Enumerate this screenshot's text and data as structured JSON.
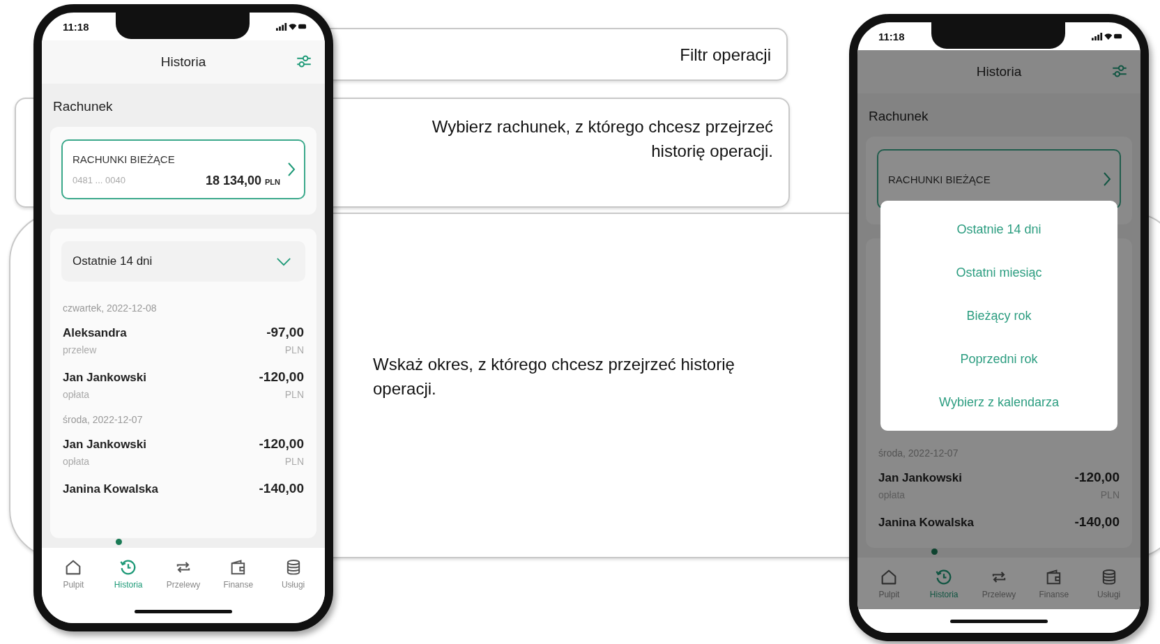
{
  "annotations": [
    {
      "text": "Filtr operacji"
    },
    {
      "text": "Wybierz rachunek, z którego chcesz przejrzeć historię operacji."
    },
    {
      "text": "Wskaż okres, z którego chcesz przejrzeć historię operacji."
    }
  ],
  "phones": [
    {
      "time": "11:18",
      "title": "Historia",
      "dimmed": false,
      "section": "Rachunek",
      "account": {
        "name": "RACHUNKI BIEŻĄCE",
        "number": "0481 ... 0040",
        "amount": "18 134,00",
        "currency": "PLN"
      },
      "period": "Ostatnie 14 dni",
      "groups": [
        {
          "date": "czwartek, 2022-12-08",
          "items": [
            {
              "name": "Aleksandra",
              "type": "przelew",
              "amount": "-97,00",
              "currency": "PLN"
            },
            {
              "name": "Jan Jankowski",
              "type": "opłata",
              "amount": "-120,00",
              "currency": "PLN"
            }
          ]
        },
        {
          "date": "środa, 2022-12-07",
          "items": [
            {
              "name": "Jan Jankowski",
              "type": "opłata",
              "amount": "-120,00",
              "currency": "PLN"
            },
            {
              "name": "Janina Kowalska",
              "amount": "-140,00"
            }
          ]
        }
      ],
      "nav": [
        {
          "label": "Pulpit",
          "selected": false
        },
        {
          "label": "Historia",
          "selected": true
        },
        {
          "label": "Przelewy",
          "selected": false
        },
        {
          "label": "Finanse",
          "selected": false
        },
        {
          "label": "Usługi",
          "selected": false
        }
      ]
    },
    {
      "time": "11:18",
      "title": "Historia",
      "dimmed": true,
      "section": "Rachunek",
      "account": {
        "name": "RACHUNKI BIEŻĄCE"
      },
      "menu": [
        "Ostatnie 14 dni",
        "Ostatni miesiąc",
        "Bieżący rok",
        "Poprzedni rok",
        "Wybierz z kalendarza"
      ],
      "groups": [
        {
          "date": "środa, 2022-12-07",
          "items": [
            {
              "name": "Jan Jankowski",
              "type": "opłata",
              "amount": "-120,00",
              "currency": "PLN"
            },
            {
              "name": "Janina Kowalska",
              "amount": "-140,00"
            }
          ]
        }
      ],
      "nav": [
        {
          "label": "Pulpit",
          "selected": false
        },
        {
          "label": "Historia",
          "selected": true
        },
        {
          "label": "Przelewy",
          "selected": false
        },
        {
          "label": "Finanse",
          "selected": false
        },
        {
          "label": "Usługi",
          "selected": false
        }
      ]
    }
  ]
}
